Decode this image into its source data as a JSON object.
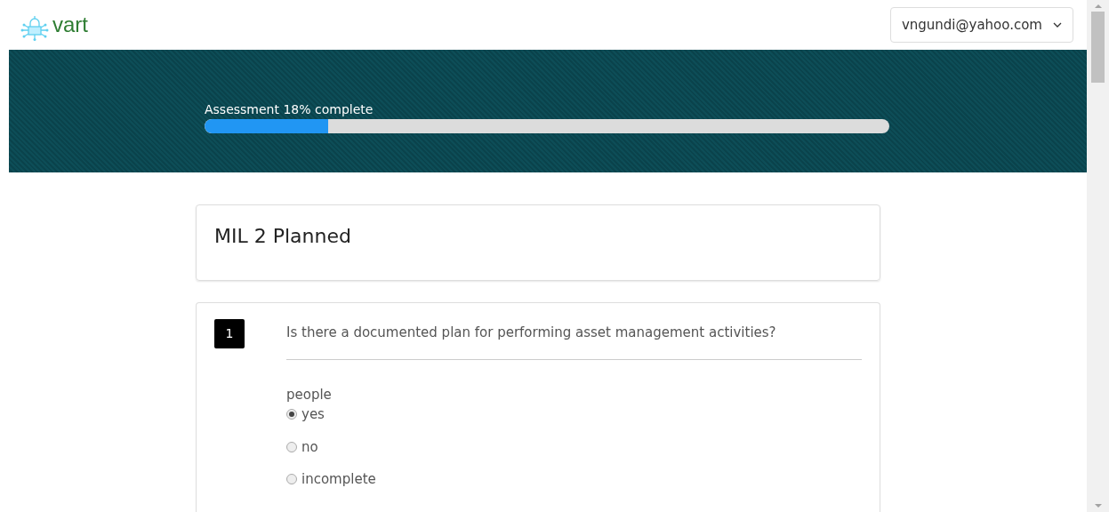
{
  "header": {
    "logo_text": "vart",
    "account": "vngundi@yahoo.com"
  },
  "progress": {
    "label": "Assessment 18% complete",
    "level": 0.18
  },
  "section": {
    "title": "MIL 2 Planned"
  },
  "questions": [
    {
      "number": "1",
      "text": "Is there a documented plan for performing asset management activities?",
      "group": "people",
      "options": [
        {
          "label": "yes",
          "selected": true
        },
        {
          "label": "no",
          "selected": false
        },
        {
          "label": "incomplete",
          "selected": false
        }
      ]
    }
  ]
}
